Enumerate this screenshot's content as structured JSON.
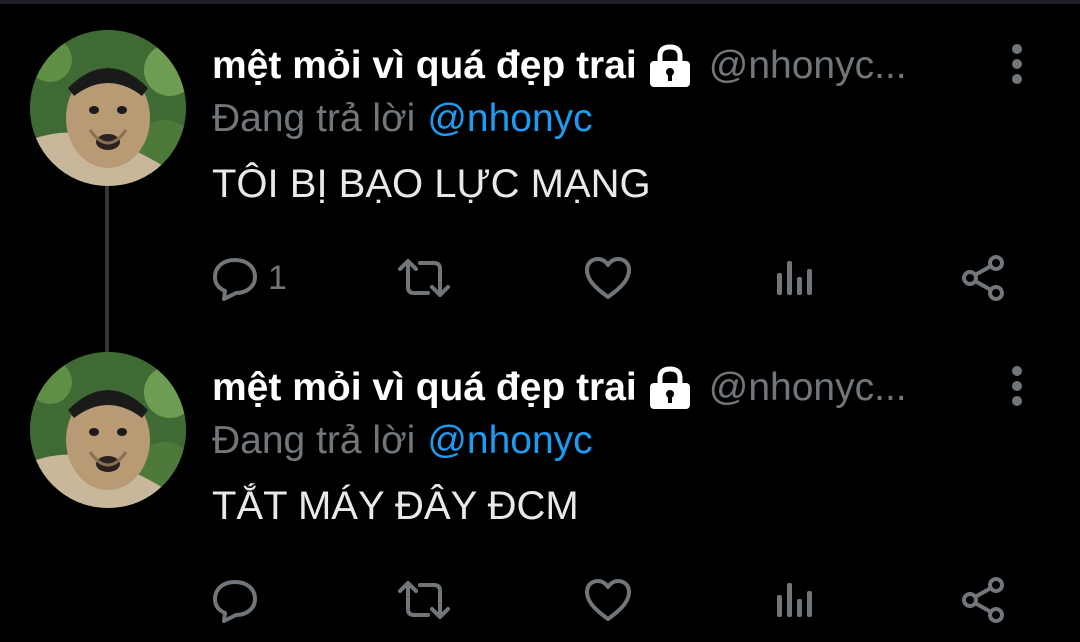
{
  "tweets": [
    {
      "display_name": "mệt mỏi vì quá đẹp trai",
      "handle": "@nhonyc...",
      "reply_prefix": "Đang trả lời",
      "reply_handle": "@nhonyc",
      "text": "TÔI BỊ BẠO LỰC MẠNG",
      "reply_count": "1",
      "icons": [
        "avatar",
        "lock-icon",
        "more-icon",
        "reply-icon",
        "retweet-icon",
        "like-icon",
        "views-icon",
        "share-icon"
      ]
    },
    {
      "display_name": "mệt mỏi vì quá đẹp trai",
      "handle": "@nhonyc...",
      "reply_prefix": "Đang trả lời",
      "reply_handle": "@nhonyc",
      "text": "TẮT MÁY ĐÂY ĐCM",
      "reply_count": "",
      "icons": [
        "avatar",
        "lock-icon",
        "more-icon",
        "reply-icon",
        "retweet-icon",
        "like-icon",
        "views-icon",
        "share-icon"
      ]
    }
  ],
  "colors": {
    "background": "#000000",
    "primary_text": "#e7e9ea",
    "secondary_text": "#71767b",
    "accent": "#1d9bf0",
    "thread_line": "#333639"
  }
}
